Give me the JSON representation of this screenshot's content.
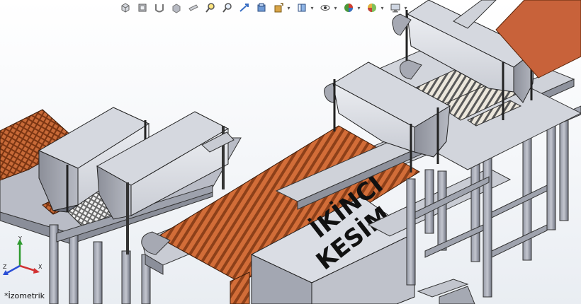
{
  "viewport": {
    "view_name": "*İzometrik",
    "triad": {
      "y": "Y",
      "z": "Z",
      "x": "X"
    }
  },
  "toolbar": [
    {
      "name": "view-cube-icon"
    },
    {
      "name": "standard-views-icon"
    },
    {
      "name": "section-view-icon"
    },
    {
      "name": "display-style-icon"
    },
    {
      "name": "hide-lines-icon"
    },
    {
      "name": "zoom-to-fit-icon"
    },
    {
      "name": "zoom-area-icon"
    },
    {
      "name": "previous-view-icon"
    },
    {
      "name": "section-box-icon"
    },
    {
      "name": "dynamic-annotation-icon"
    },
    {
      "name": "view-orientation-icon"
    },
    {
      "name": "visibility-icon"
    },
    {
      "name": "appearance-icon"
    },
    {
      "name": "scene-icon"
    },
    {
      "name": "display-settings-icon"
    }
  ],
  "model": {
    "box_label_line1": "İKİNCİ",
    "box_label_line2": "KESİM",
    "colors": {
      "frame": "#7f8391",
      "frame_dark": "#5b5f6b",
      "copper": "#c2602e",
      "copper_dark": "#8e3f17",
      "steel_light": "#dfe1e8",
      "steel": "#b9bcc7"
    }
  }
}
